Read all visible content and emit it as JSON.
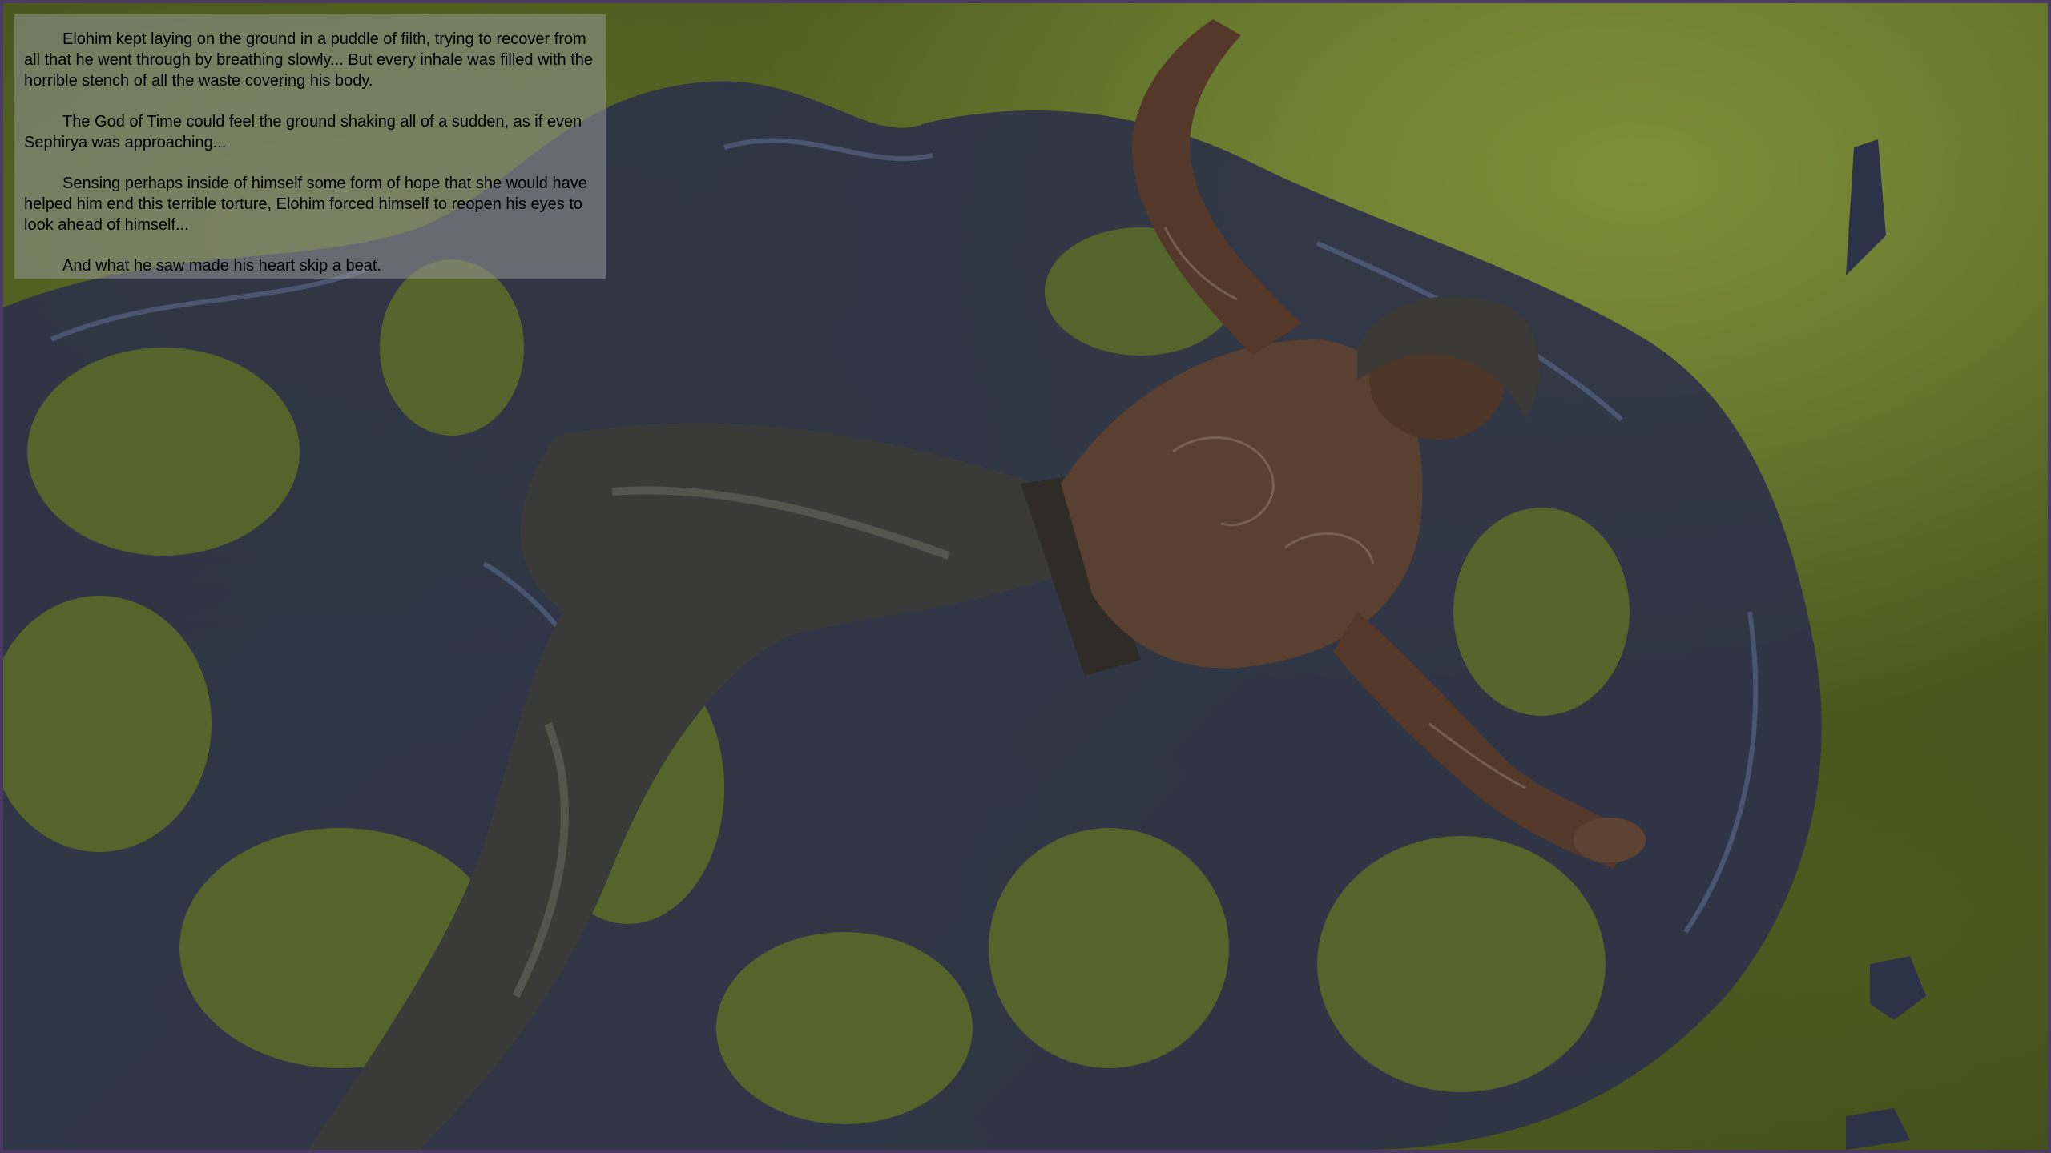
{
  "narration": {
    "paragraphs": [
      "Elohim kept laying on the ground in a puddle of filth, trying to recover from all that he went through by breathing slowly... But every inhale was filled with the horrible stench of all the waste covering his body.",
      "The God of Time could feel the ground shaking all of a sudden, as if even Sephirya was approaching...",
      "Sensing perhaps inside of himself some form of hope that she would have helped him end this terrible torture, Elohim forced himself to reopen his eyes to look ahead of himself...",
      "And what he saw made his heart skip a beat."
    ]
  },
  "scene": {
    "description_icon": "lying-character-illustration",
    "colors": {
      "frame": "#4b3a63",
      "ground": "#5c6c26",
      "filth": "#2c3248",
      "skin": "#5a4030",
      "pants": "#3a3a38",
      "textbox": "#969696"
    }
  }
}
